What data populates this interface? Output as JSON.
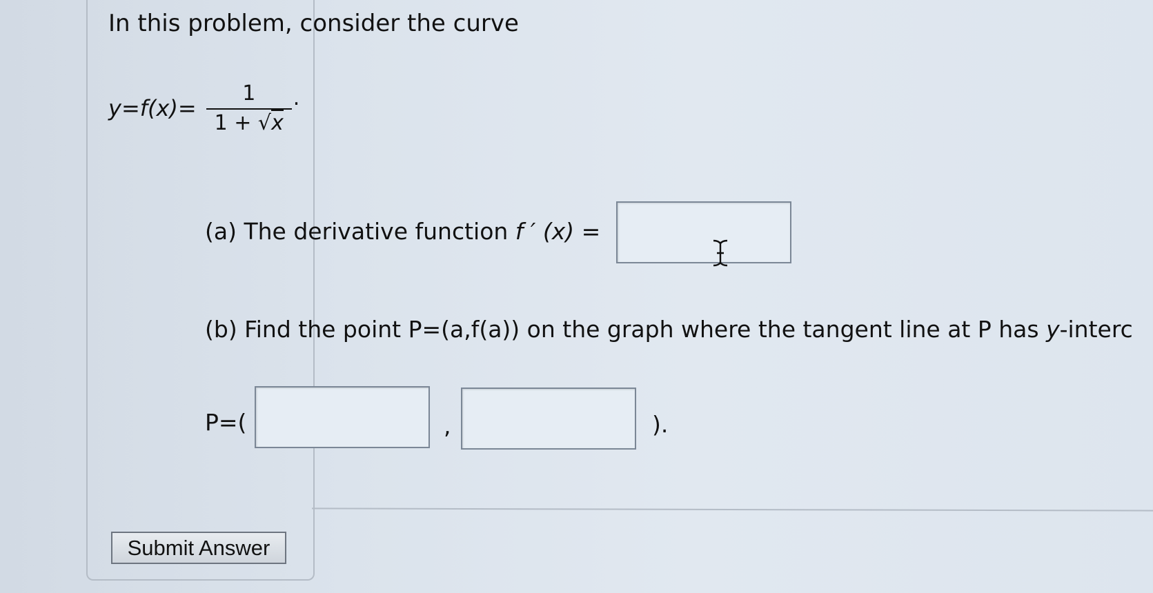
{
  "problem": {
    "intro": "In this problem, consider the curve",
    "formula_lhs": "y=f(x)=",
    "formula_numerator": "1",
    "formula_denominator_prefix": "1 + √",
    "formula_denominator_var": "x",
    "formula_period": "."
  },
  "part_a": {
    "label_prefix": "(a) The derivative function ",
    "label_fx": "f ′ (x)",
    "label_suffix": " =",
    "answer_value": ""
  },
  "part_b": {
    "label_prefix": "(b) Find the point P=(a,f(a)) on the graph where the tangent line at P has ",
    "label_var": "y",
    "label_suffix": "-interc",
    "point_label": "P=(",
    "comma": ",",
    "close": ").",
    "x_value": "",
    "y_value": ""
  },
  "submit_label": "Submit Answer",
  "icons": {
    "cursor": "text-cursor-icon"
  }
}
